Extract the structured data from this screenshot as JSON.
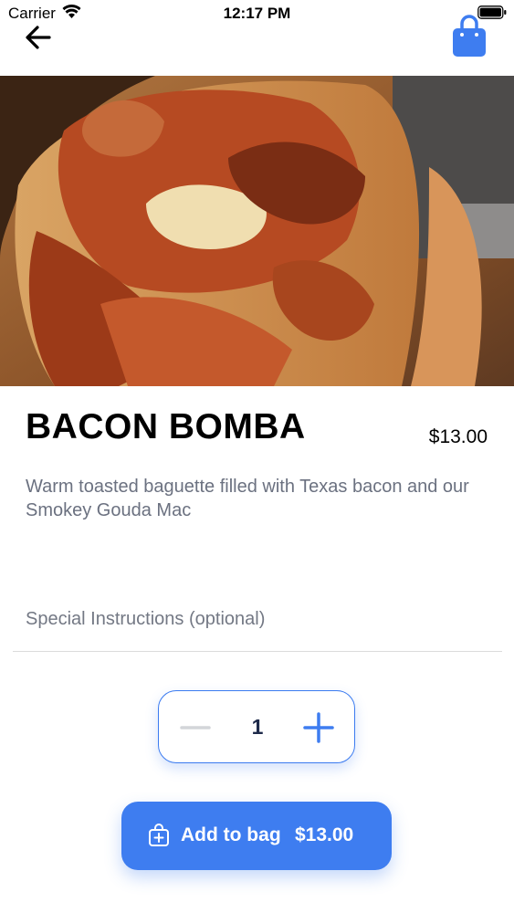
{
  "status_bar": {
    "carrier": "Carrier",
    "time": "12:17 PM"
  },
  "header": {
    "back_icon": "arrow-left-icon",
    "bag_icon": "shopping-bag-icon",
    "accent": "#3e7df0"
  },
  "product": {
    "title": "BACON BOMBA",
    "price": "$13.00",
    "description": "Warm toasted baguette filled with Texas bacon and our Smokey Gouda Mac"
  },
  "instructions": {
    "placeholder": "Special Instructions (optional)"
  },
  "quantity": {
    "value": "1",
    "minus_icon": "minus-icon",
    "plus_icon": "plus-icon"
  },
  "add_button": {
    "label": "Add to bag",
    "price": "$13.00",
    "icon": "bag-plus-icon"
  }
}
